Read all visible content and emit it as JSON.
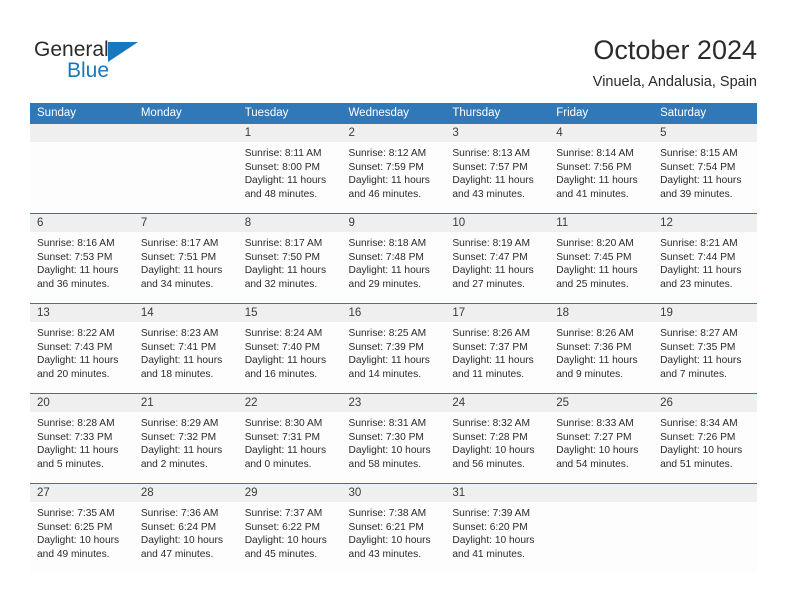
{
  "brand": {
    "name_top": "General",
    "name_bottom": "Blue",
    "triangle_icon": "blue-triangle-logo-mark",
    "accent_color": "#1878be"
  },
  "header": {
    "title": "October 2024",
    "subtitle": "Vinuela, Andalusia, Spain"
  },
  "theme": {
    "header_blue": "#3178b8",
    "daynum_band": "#efefef",
    "row_separator": "#2f78b8",
    "text": "#2b2b2b"
  },
  "weekday_headers": [
    "Sunday",
    "Monday",
    "Tuesday",
    "Wednesday",
    "Thursday",
    "Friday",
    "Saturday"
  ],
  "labels": {
    "sunrise_prefix": "Sunrise:",
    "sunset_prefix": "Sunset:",
    "daylight_prefix": "Daylight:"
  },
  "weeks": [
    [
      {
        "day": "",
        "lines": []
      },
      {
        "day": "",
        "lines": []
      },
      {
        "day": "1",
        "lines": [
          "Sunrise: 8:11 AM",
          "Sunset: 8:00 PM",
          "Daylight: 11 hours",
          "and 48 minutes."
        ]
      },
      {
        "day": "2",
        "lines": [
          "Sunrise: 8:12 AM",
          "Sunset: 7:59 PM",
          "Daylight: 11 hours",
          "and 46 minutes."
        ]
      },
      {
        "day": "3",
        "lines": [
          "Sunrise: 8:13 AM",
          "Sunset: 7:57 PM",
          "Daylight: 11 hours",
          "and 43 minutes."
        ]
      },
      {
        "day": "4",
        "lines": [
          "Sunrise: 8:14 AM",
          "Sunset: 7:56 PM",
          "Daylight: 11 hours",
          "and 41 minutes."
        ]
      },
      {
        "day": "5",
        "lines": [
          "Sunrise: 8:15 AM",
          "Sunset: 7:54 PM",
          "Daylight: 11 hours",
          "and 39 minutes."
        ]
      }
    ],
    [
      {
        "day": "6",
        "lines": [
          "Sunrise: 8:16 AM",
          "Sunset: 7:53 PM",
          "Daylight: 11 hours",
          "and 36 minutes."
        ]
      },
      {
        "day": "7",
        "lines": [
          "Sunrise: 8:17 AM",
          "Sunset: 7:51 PM",
          "Daylight: 11 hours",
          "and 34 minutes."
        ]
      },
      {
        "day": "8",
        "lines": [
          "Sunrise: 8:17 AM",
          "Sunset: 7:50 PM",
          "Daylight: 11 hours",
          "and 32 minutes."
        ]
      },
      {
        "day": "9",
        "lines": [
          "Sunrise: 8:18 AM",
          "Sunset: 7:48 PM",
          "Daylight: 11 hours",
          "and 29 minutes."
        ]
      },
      {
        "day": "10",
        "lines": [
          "Sunrise: 8:19 AM",
          "Sunset: 7:47 PM",
          "Daylight: 11 hours",
          "and 27 minutes."
        ]
      },
      {
        "day": "11",
        "lines": [
          "Sunrise: 8:20 AM",
          "Sunset: 7:45 PM",
          "Daylight: 11 hours",
          "and 25 minutes."
        ]
      },
      {
        "day": "12",
        "lines": [
          "Sunrise: 8:21 AM",
          "Sunset: 7:44 PM",
          "Daylight: 11 hours",
          "and 23 minutes."
        ]
      }
    ],
    [
      {
        "day": "13",
        "lines": [
          "Sunrise: 8:22 AM",
          "Sunset: 7:43 PM",
          "Daylight: 11 hours",
          "and 20 minutes."
        ]
      },
      {
        "day": "14",
        "lines": [
          "Sunrise: 8:23 AM",
          "Sunset: 7:41 PM",
          "Daylight: 11 hours",
          "and 18 minutes."
        ]
      },
      {
        "day": "15",
        "lines": [
          "Sunrise: 8:24 AM",
          "Sunset: 7:40 PM",
          "Daylight: 11 hours",
          "and 16 minutes."
        ]
      },
      {
        "day": "16",
        "lines": [
          "Sunrise: 8:25 AM",
          "Sunset: 7:39 PM",
          "Daylight: 11 hours",
          "and 14 minutes."
        ]
      },
      {
        "day": "17",
        "lines": [
          "Sunrise: 8:26 AM",
          "Sunset: 7:37 PM",
          "Daylight: 11 hours",
          "and 11 minutes."
        ]
      },
      {
        "day": "18",
        "lines": [
          "Sunrise: 8:26 AM",
          "Sunset: 7:36 PM",
          "Daylight: 11 hours",
          "and 9 minutes."
        ]
      },
      {
        "day": "19",
        "lines": [
          "Sunrise: 8:27 AM",
          "Sunset: 7:35 PM",
          "Daylight: 11 hours",
          "and 7 minutes."
        ]
      }
    ],
    [
      {
        "day": "20",
        "lines": [
          "Sunrise: 8:28 AM",
          "Sunset: 7:33 PM",
          "Daylight: 11 hours",
          "and 5 minutes."
        ]
      },
      {
        "day": "21",
        "lines": [
          "Sunrise: 8:29 AM",
          "Sunset: 7:32 PM",
          "Daylight: 11 hours",
          "and 2 minutes."
        ]
      },
      {
        "day": "22",
        "lines": [
          "Sunrise: 8:30 AM",
          "Sunset: 7:31 PM",
          "Daylight: 11 hours",
          "and 0 minutes."
        ]
      },
      {
        "day": "23",
        "lines": [
          "Sunrise: 8:31 AM",
          "Sunset: 7:30 PM",
          "Daylight: 10 hours",
          "and 58 minutes."
        ]
      },
      {
        "day": "24",
        "lines": [
          "Sunrise: 8:32 AM",
          "Sunset: 7:28 PM",
          "Daylight: 10 hours",
          "and 56 minutes."
        ]
      },
      {
        "day": "25",
        "lines": [
          "Sunrise: 8:33 AM",
          "Sunset: 7:27 PM",
          "Daylight: 10 hours",
          "and 54 minutes."
        ]
      },
      {
        "day": "26",
        "lines": [
          "Sunrise: 8:34 AM",
          "Sunset: 7:26 PM",
          "Daylight: 10 hours",
          "and 51 minutes."
        ]
      }
    ],
    [
      {
        "day": "27",
        "lines": [
          "Sunrise: 7:35 AM",
          "Sunset: 6:25 PM",
          "Daylight: 10 hours",
          "and 49 minutes."
        ]
      },
      {
        "day": "28",
        "lines": [
          "Sunrise: 7:36 AM",
          "Sunset: 6:24 PM",
          "Daylight: 10 hours",
          "and 47 minutes."
        ]
      },
      {
        "day": "29",
        "lines": [
          "Sunrise: 7:37 AM",
          "Sunset: 6:22 PM",
          "Daylight: 10 hours",
          "and 45 minutes."
        ]
      },
      {
        "day": "30",
        "lines": [
          "Sunrise: 7:38 AM",
          "Sunset: 6:21 PM",
          "Daylight: 10 hours",
          "and 43 minutes."
        ]
      },
      {
        "day": "31",
        "lines": [
          "Sunrise: 7:39 AM",
          "Sunset: 6:20 PM",
          "Daylight: 10 hours",
          "and 41 minutes."
        ]
      },
      {
        "day": "",
        "lines": []
      },
      {
        "day": "",
        "lines": []
      }
    ]
  ]
}
